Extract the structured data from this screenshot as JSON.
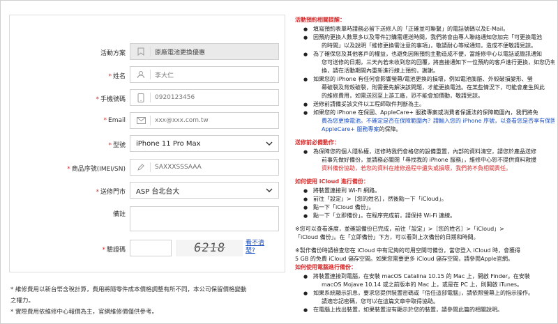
{
  "form": {
    "fields": {
      "plan": {
        "label": "活動方案",
        "value": "原廠電池更換優惠"
      },
      "name": {
        "label": "姓名",
        "placeholder": "李大仁"
      },
      "phone": {
        "label": "手機號碼",
        "placeholder": "0920123456"
      },
      "email": {
        "label": "Email",
        "placeholder": "xxx@xxx.com.tw"
      },
      "model": {
        "label": "型號",
        "value": "iPhone 11 Pro Max"
      },
      "imei": {
        "label": "商品序號(IMEI/SN)",
        "value": "SAXXXSSSAAA"
      },
      "store": {
        "label": "送修門市",
        "value": "ASP 台北台大"
      },
      "remark": {
        "label": "備註"
      },
      "captcha": {
        "label": "驗證碼",
        "code": "6218",
        "refresh": "看不清楚?"
      }
    },
    "required_mark": "*"
  },
  "notes": [
    "* 維修費用以新台幣含稅計算，費用將隨零件成本價格調整有所不同，本公司保留價格變動",
    "之權力。",
    "* 實際費用依維修中心報價為主，官網維修價僅供參考。"
  ],
  "info": {
    "sec1": {
      "title": "活動預約相關提醒：",
      "items": [
        [
          "填寫預約表單時請務必留下送修人的「正確並可聯繫」的電話號碼以及E-Mail。"
        ],
        [
          "因預約更換人數眾多以及零件訂購需運送時間，我們將會由專人聯絡通知您加完「可更換電池",
          "的時間」以及說明「維修更換需注意的事項」，敬請耐心等候通知，造成不便敬請見諒。"
        ],
        [
          "為了確保您及其他客戶的權益，也避免因無預約主動造成不便，當維修中心以電話或簡訊通知",
          "您可送修的日期，三天內若未收到您的回覆，將直接通知下一位預約的客戶進行更換，如您仍有需求更",
          "換，請在活動期間內重新進行線上預約，謝謝。"
        ],
        [
          "如果您的 iPhone 有任何會影響螢幕/電池更換的損壞，例如電池膨脹、外殼破損變形、螢",
          "幕破裂及背殼破裂，則需要先解決該問題，才能更換電池。在某些情況下，可能會產生與此",
          "的維修費用，如需送回至上游工廠，恐不能會加價動，敬請見諒。"
        ],
        [
          "送修前請備妥該文件以工程師取件判斷為主。"
        ],
        [
          "如果您的 iPhone 在保固、AppleCare+ 服務專案或消費者保護法的保障範圍內，我們將免",
          "費為您更換電池。不確定是否在保障範圍內？請輸入您的 iPhone 序號，以查看您是否享有保固或"
        ]
      ],
      "link_tail": "AppleCare+ 服務專案",
      "link_tail_suffix": "的保障。"
    },
    "sec2": {
      "title": "送修前必備動作：",
      "lines": [
        "為保障您的個人隱私權，送修時我們會格您的設備重置，內部的資料清空，請您於產品送修",
        "前事先做好備份，並請務必關閉「尋找我的 iPhone 服務」，維修中心恕不提供資料救援",
        "資料備份協助，若您的資料在維修過程中遺失或損壞，我們將不負相關責任。"
      ]
    },
    "sec3": {
      "title": "如何使用 iCloud 進行備份：",
      "items": [
        "將裝置連接到 Wi-Fi 網路。",
        "前往「設定」>［您的姓名］，然後點一下「iCloud」。",
        "點一下「iCloud 備份」。",
        "點一下「立即備份」。在程序完成前，請保持 Wi-Fi 連線。"
      ]
    },
    "para1": [
      "※您可以查看進度，並確認備份已完成，前往「設定」>［您的姓名］>「iCloud」>",
      "「iCloud 備份」。在「立即備份」下方，可以看到上次備份的日期和時間。"
    ],
    "para2": [
      "※製作備份時請檢查您在 iCloud 中有足夠的可用空間可備份，當您登入 iCloud 時，會獲得",
      "5 GB 的免費 iCloud 儲存空間。如果您需要更多 iCloud 儲存空間，請參閱Apple官網。"
    ],
    "sec4": {
      "title": "如何使用電腦進行備份：",
      "items": [
        [
          "將裝置連接到電腦，在安裝 macOS Catalina 10.15 的 Mac 上，開啟 Finder。在安裝",
          "macOS Mojave 10.14 或之前版本的 Mac 上，或是在 PC 上，則開啟 iTunes。"
        ],
        [
          "如果系統顯示訊息，要求您提供裝置密碼或「信任這部電腦」，請依照螢幕上的指示操作。",
          "請適忘記密碼，您可以在這篇文章中取得協助。"
        ],
        [
          "在電腦上找出裝置，如果裝置沒有顯示於您的裝置，請參閱此篇的相關說明。"
        ]
      ]
    }
  }
}
